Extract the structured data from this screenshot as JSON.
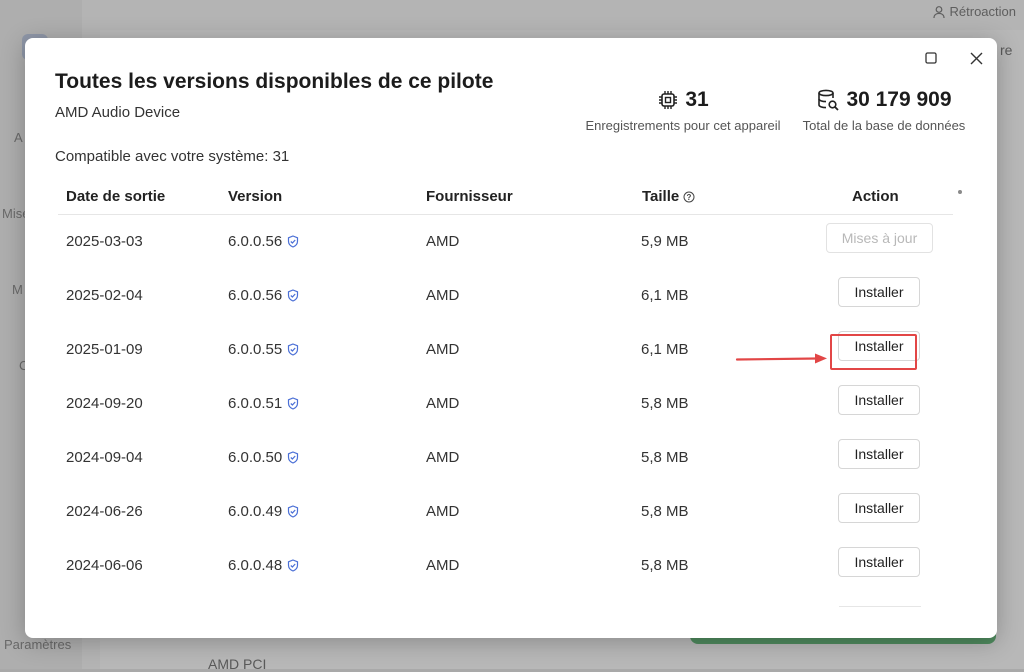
{
  "background": {
    "feedback_label": "Rétroaction",
    "settings_label": "Paramètres",
    "side_labels": [
      "A",
      "Mise",
      "M",
      "C"
    ],
    "bottom_text": "AMD PCI",
    "right_char": "re"
  },
  "modal": {
    "title": "Toutes les versions disponibles de ce pilote",
    "device_name": "AMD Audio Device",
    "compat_text": "Compatible avec votre système: 31",
    "stats": {
      "records_value": "31",
      "records_label": "Enregistrements pour cet appareil",
      "db_value": "30 179 909",
      "db_label": "Total de la base de données"
    },
    "table": {
      "headers": {
        "date": "Date de sortie",
        "version": "Version",
        "vendor": "Fournisseur",
        "size": "Taille",
        "action": "Action"
      },
      "rows": [
        {
          "date": "2025-03-03",
          "version": "6.0.0.56",
          "vendor": "AMD",
          "size": "5,9 MB",
          "action": "Mises à jour"
        },
        {
          "date": "2025-02-04",
          "version": "6.0.0.56",
          "vendor": "AMD",
          "size": "6,1 MB",
          "action": "Installer"
        },
        {
          "date": "2025-01-09",
          "version": "6.0.0.55",
          "vendor": "AMD",
          "size": "6,1 MB",
          "action": "Installer"
        },
        {
          "date": "2024-09-20",
          "version": "6.0.0.51",
          "vendor": "AMD",
          "size": "5,8 MB",
          "action": "Installer"
        },
        {
          "date": "2024-09-04",
          "version": "6.0.0.50",
          "vendor": "AMD",
          "size": "5,8 MB",
          "action": "Installer"
        },
        {
          "date": "2024-06-26",
          "version": "6.0.0.49",
          "vendor": "AMD",
          "size": "5,8 MB",
          "action": "Installer"
        },
        {
          "date": "2024-06-06",
          "version": "6.0.0.48",
          "vendor": "AMD",
          "size": "5,8 MB",
          "action": "Installer"
        }
      ]
    }
  },
  "colors": {
    "highlight": "#e24646",
    "verified_icon": "#4a6fd6"
  }
}
